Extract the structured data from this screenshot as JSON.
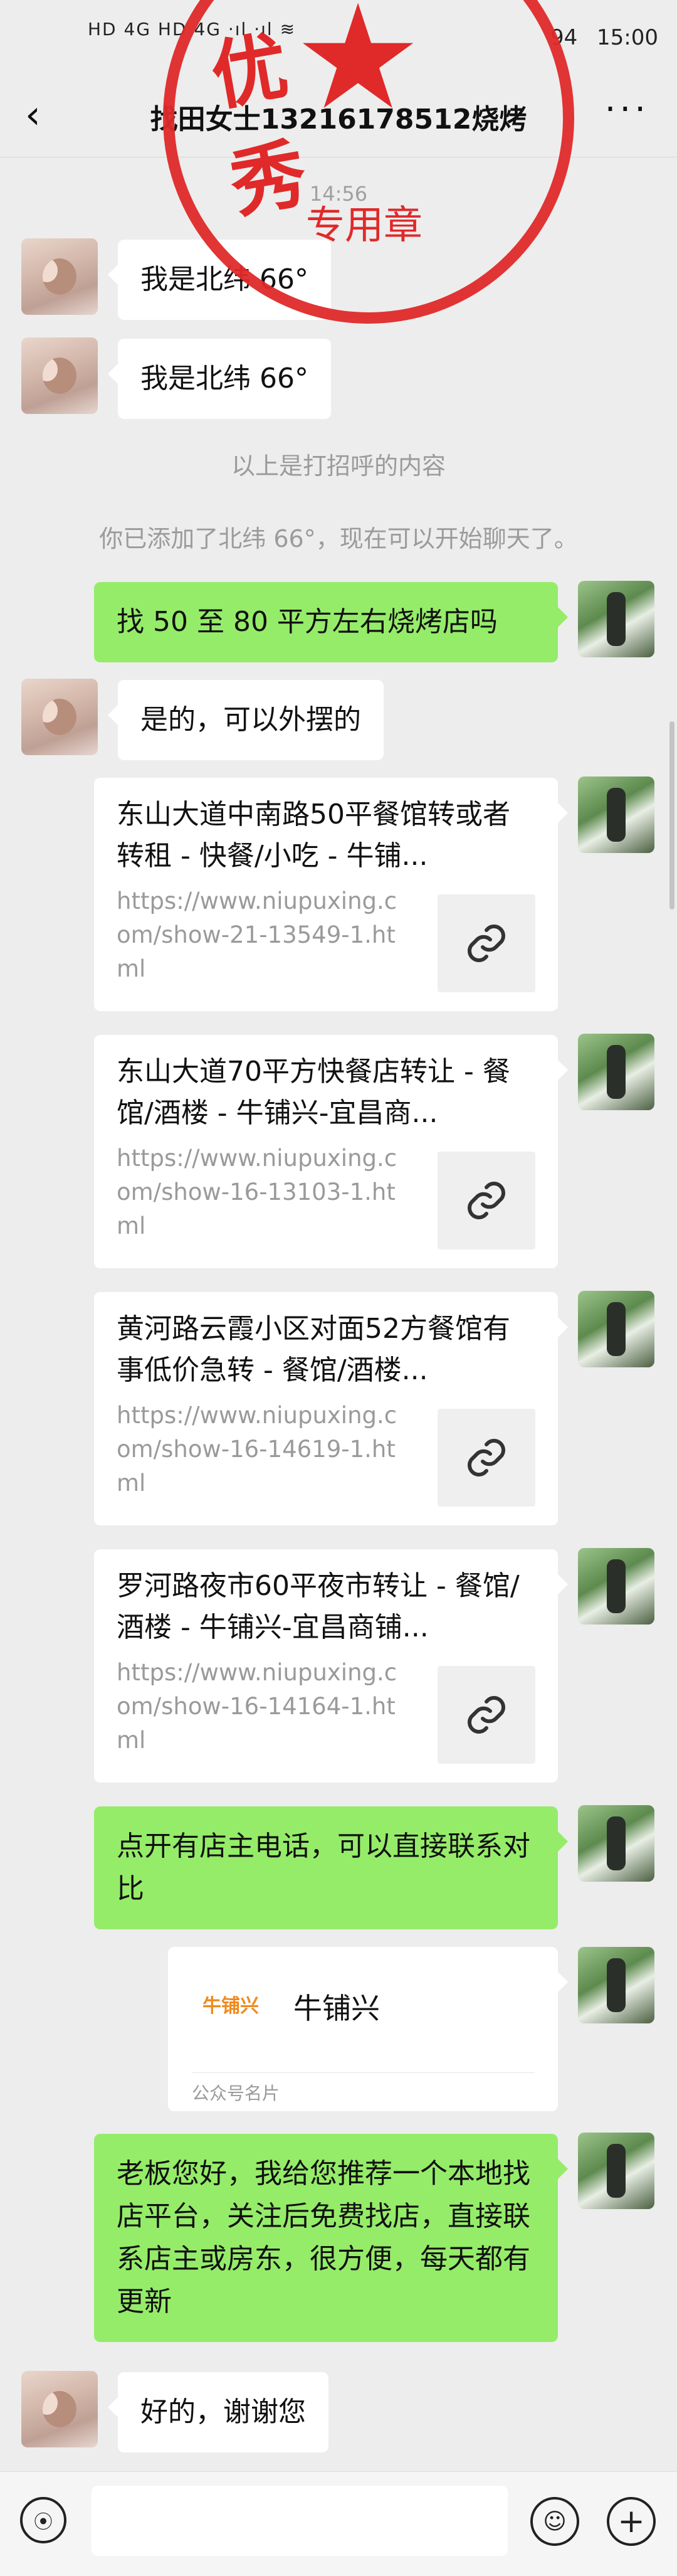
{
  "status_bar": {
    "left_indicators": "HD 4G HD 4G ·ıl ·ıl ≋",
    "time": "15:00",
    "battery": "94"
  },
  "header": {
    "title": "找田女士13216178512烧烤",
    "back_icon": "back-arrow-icon",
    "more_icon": "more-dots-icon"
  },
  "seal": {
    "top_text": "优秀",
    "bottom_text": "专用章",
    "color": "#e02a2a"
  },
  "chat": {
    "timestamp": "14:56",
    "greetings": [
      {
        "text": "我是北纬 66°"
      },
      {
        "text": "我是北纬 66°"
      }
    ],
    "system_notes": [
      "以上是打招呼的内容",
      "你已添加了北纬 66°，现在可以开始聊天了。"
    ],
    "msg_ask": "找 50 至 80 平方左右烧烤店吗",
    "msg_reply": "是的，可以外摆的",
    "links": [
      {
        "title": "东山大道中南路50平餐馆转或者转租 - 快餐/小吃 - 牛铺...",
        "url": "https://www.niupuxing.com/show-21-13549-1.html"
      },
      {
        "title": "东山大道70平方快餐店转让 - 餐馆/酒楼 - 牛铺兴-宜昌商...",
        "url": "https://www.niupuxing.com/show-16-13103-1.html"
      },
      {
        "title": "黄河路云霞小区对面52方餐馆有事低价急转 - 餐馆/酒楼...",
        "url": "https://www.niupuxing.com/show-16-14619-1.html"
      },
      {
        "title": "罗河路夜市60平夜市转让 - 餐馆/酒楼 - 牛铺兴-宜昌商铺...",
        "url": "https://www.niupuxing.com/show-16-14164-1.html"
      }
    ],
    "msg_phone": "点开有店主电话，可以直接联系对比",
    "profile_card": {
      "logo_text": "牛铺兴",
      "name": "牛铺兴",
      "type": "公众号名片"
    },
    "msg_recommend": "老板您好，我给您推荐一个本地找店平台，关注后免费找店，直接联系店主或房东，很方便，每天都有更新",
    "msg_thanks": "好的，谢谢您"
  },
  "input_bar": {
    "voice_icon": "voice-icon",
    "emoji_icon": "emoji-icon",
    "plus_icon": "plus-icon"
  },
  "colors": {
    "background": "#ededed",
    "sent_bubble": "#95ec69",
    "received_bubble": "#ffffff"
  }
}
